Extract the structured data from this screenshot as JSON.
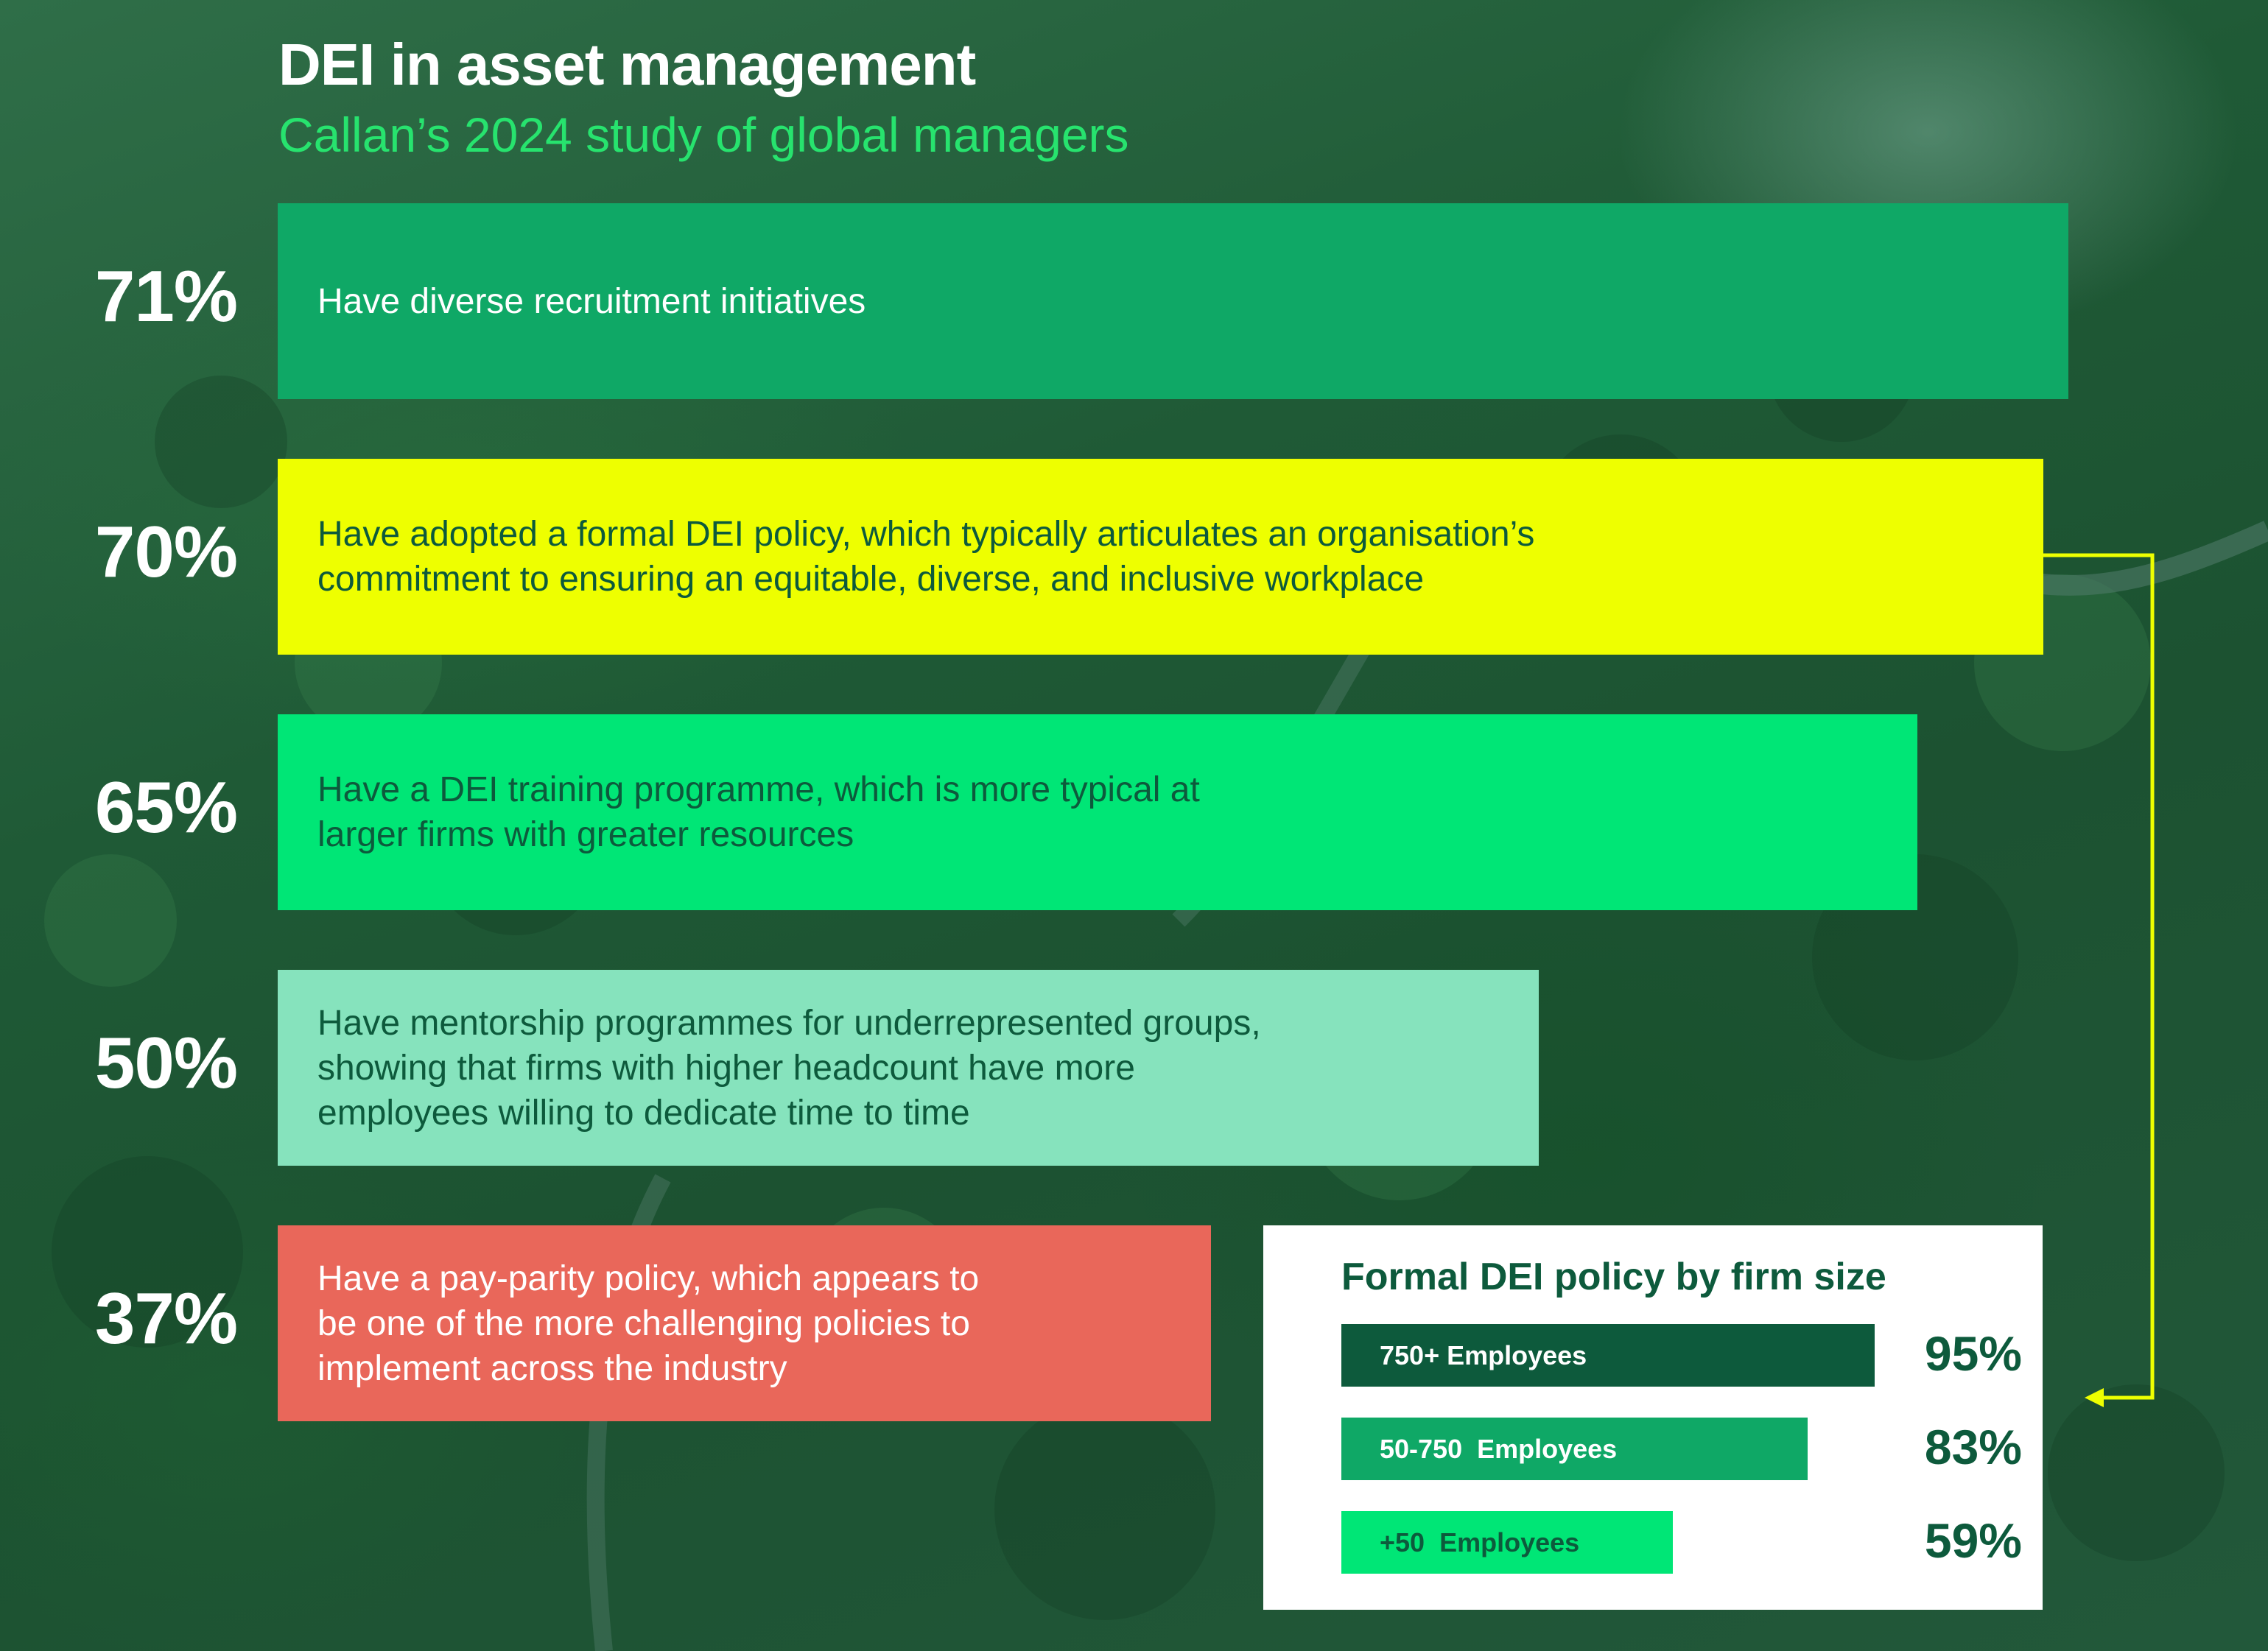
{
  "title": "DEI in asset management",
  "subtitle": "Callan’s 2024 study of global managers",
  "colors": {
    "dark_green": "#0d5a3c",
    "mid_green": "#0fa866",
    "bright_green": "#00e676",
    "yellow": "#eeff00",
    "mint": "#86e3bd",
    "coral": "#e9675a",
    "connector": "#eeff00"
  },
  "chart_data": [
    {
      "type": "bar",
      "orientation": "horizontal",
      "categories": [
        "Have diverse recruitment initiatives",
        "Have adopted a formal DEI policy, which typically articulates an organisation’s\ncommitment to ensuring an equitable, diverse, and inclusive workplace",
        "Have a DEI training programme, which is more typical at\nlarger firms with greater resources",
        "Have mentorship programmes for underrepresented groups,\nshowing that firms with higher headcount have more\nemployees willing to dedicate time to time",
        "Have a pay-parity policy, which appears to\nbe one of the more challenging policies to\nimplement across the industry"
      ],
      "values": [
        71,
        70,
        65,
        50,
        37
      ],
      "value_labels": [
        "71%",
        "70%",
        "65%",
        "50%",
        "37%"
      ],
      "bar_colors": [
        "#0fa866",
        "#eeff00",
        "#00e676",
        "#86e3bd",
        "#e9675a"
      ],
      "text_colors": [
        "#ffffff",
        "#0d5a3c",
        "#0d5a3c",
        "#0d5a3c",
        "#ffffff"
      ],
      "title": "DEI in asset management",
      "subtitle": "Callan’s 2024 study of global managers",
      "xlim": [
        0,
        71
      ]
    },
    {
      "type": "bar",
      "orientation": "horizontal",
      "title": "Formal DEI policy by firm size",
      "categories": [
        "750+ Employees",
        "50-750  Employees",
        "+50  Employees"
      ],
      "values": [
        95,
        83,
        59
      ],
      "value_labels": [
        "95%",
        "83%",
        "59%"
      ],
      "bar_colors": [
        "#0d5a3c",
        "#0fa866",
        "#00e676"
      ],
      "text_colors": [
        "#ffffff",
        "#ffffff",
        "#0d5a3c"
      ]
    }
  ]
}
